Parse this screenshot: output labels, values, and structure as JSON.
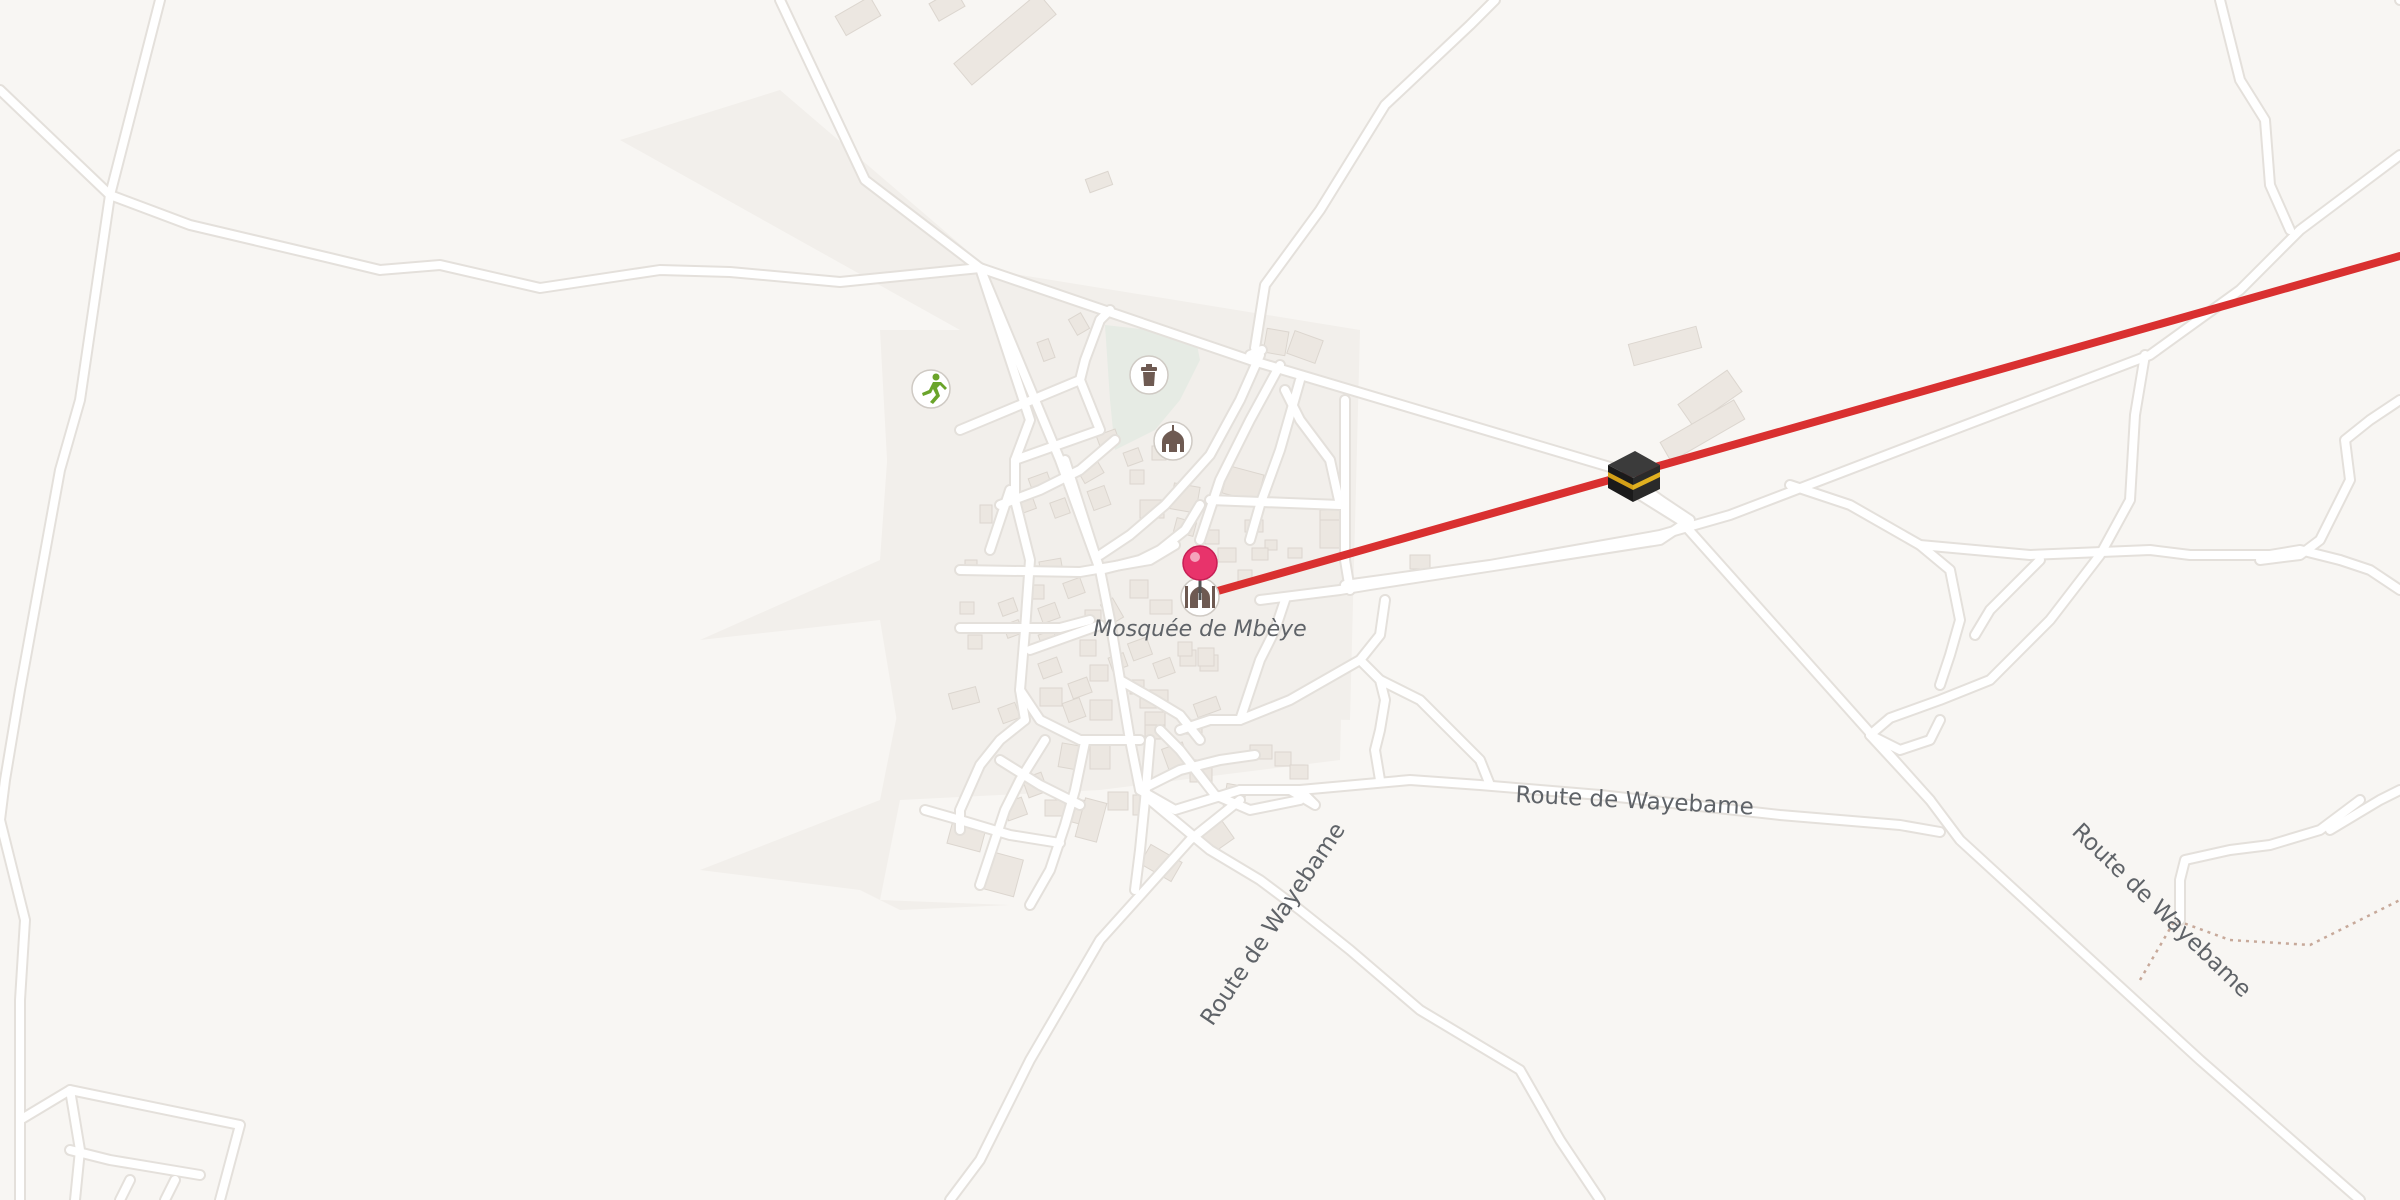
{
  "map": {
    "labels": {
      "mosque": "Mosquée de Mbèye",
      "road_east": "Route de Wayebame",
      "road_sw": "Route de Wayebame",
      "road_se": "Route de Wayebame"
    },
    "markers": {
      "pin": "location-pin-icon",
      "kaaba": "kaaba-icon",
      "mosque": "mosque-icon",
      "sports": "sports-runner-icon",
      "cemetery": "cemetery-icon"
    },
    "colors": {
      "background": "#f8f6f3",
      "qibla_line": "#d93030",
      "pin": "#e8336b",
      "park": "#e6ebe4",
      "sports_icon": "#6aa42a",
      "text": "#5f6368"
    }
  }
}
